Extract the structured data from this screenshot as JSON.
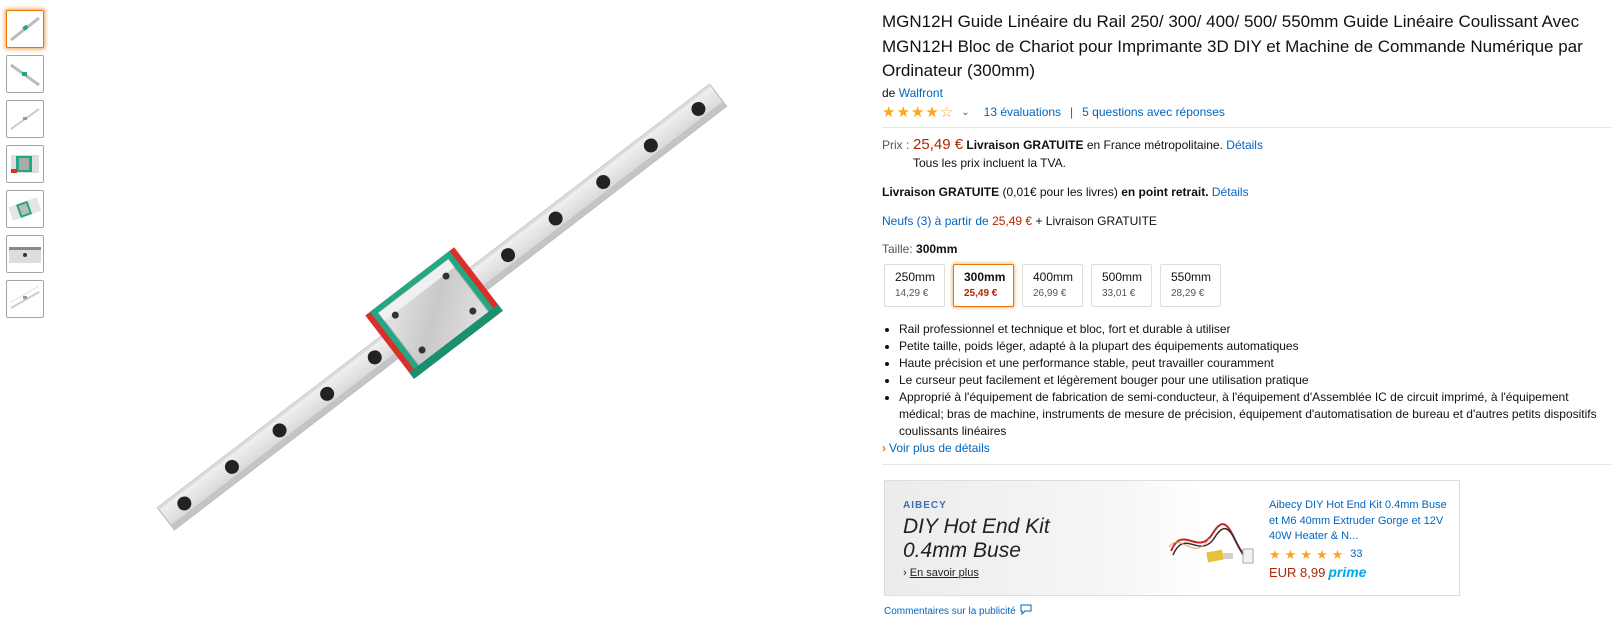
{
  "product": {
    "title": "MGN12H Guide Linéaire du Rail 250/ 300/ 400/ 500/ 550mm Guide Linéaire Coulissant Avec MGN12H Bloc de Chariot pour Imprimante 3D DIY et Machine de Commande Numérique par Ordinateur (300mm)",
    "by_prefix": "de",
    "brand": "Walfront",
    "rating_stars": 4,
    "reviews_label": "13 évaluations",
    "questions_label": "5 questions avec réponses",
    "sep": "|"
  },
  "price": {
    "label": "Prix :",
    "value": "25,49 €",
    "delivery_bold": "Livraison GRATUITE",
    "delivery_rest": "en France métropolitaine.",
    "details_link": "Détails",
    "vat_note": "Tous les prix incluent la TVA."
  },
  "relay": {
    "bold1": "Livraison GRATUITE",
    "mid": "(0,01€ pour les livres)",
    "bold2": "en point retrait.",
    "details_link": "Détails"
  },
  "offers": {
    "link": "Neufs (3) à partir de",
    "price": "25,49 €",
    "suffix": "+ Livraison GRATUITE"
  },
  "size": {
    "label": "Taille:",
    "selected": "300mm",
    "options": [
      {
        "name": "250mm",
        "price": "14,29 €"
      },
      {
        "name": "300mm",
        "price": "25,49 €"
      },
      {
        "name": "400mm",
        "price": "26,99 €"
      },
      {
        "name": "500mm",
        "price": "33,01 €"
      },
      {
        "name": "550mm",
        "price": "28,29 €"
      }
    ]
  },
  "bullets": [
    "Rail professionnel et technique et bloc, fort et durable à utiliser",
    "Petite taille, poids léger, adapté à la plupart des équipements automatiques",
    "Haute précision et une performance stable, peut travailler couramment",
    "Le curseur peut facilement et légèrement bouger pour une utilisation pratique",
    "Approprié à l'équipement de fabrication de semi-conducteur, à l'équipement d'Assemblée IC de circuit imprimé, à l'équipement médical; bras de machine, instruments de mesure de précision, équipement d'automatisation de bureau et d'autres petits dispositifs coulissants linéaires"
  ],
  "more_details": "Voir plus de détails",
  "ad": {
    "brand": "AIBECY",
    "headline_1": "DIY Hot End Kit",
    "headline_2": "0.4mm Buse",
    "learn_more": "En savoir plus",
    "product_title": "Aibecy DIY Hot End Kit 0.4mm Buse et M6 40mm Extruder Gorge et 12V 40W Heater & N...",
    "rating_count": "33",
    "price": "EUR 8,99",
    "prime": "prime",
    "feedback": "Commentaires sur la publicité"
  },
  "colors": {
    "link": "#0066c0",
    "price": "#b12704",
    "star": "#ffa41c",
    "selected_border": "#e77600",
    "carriage_green": "#22a884",
    "carriage_red": "#d9302c"
  }
}
